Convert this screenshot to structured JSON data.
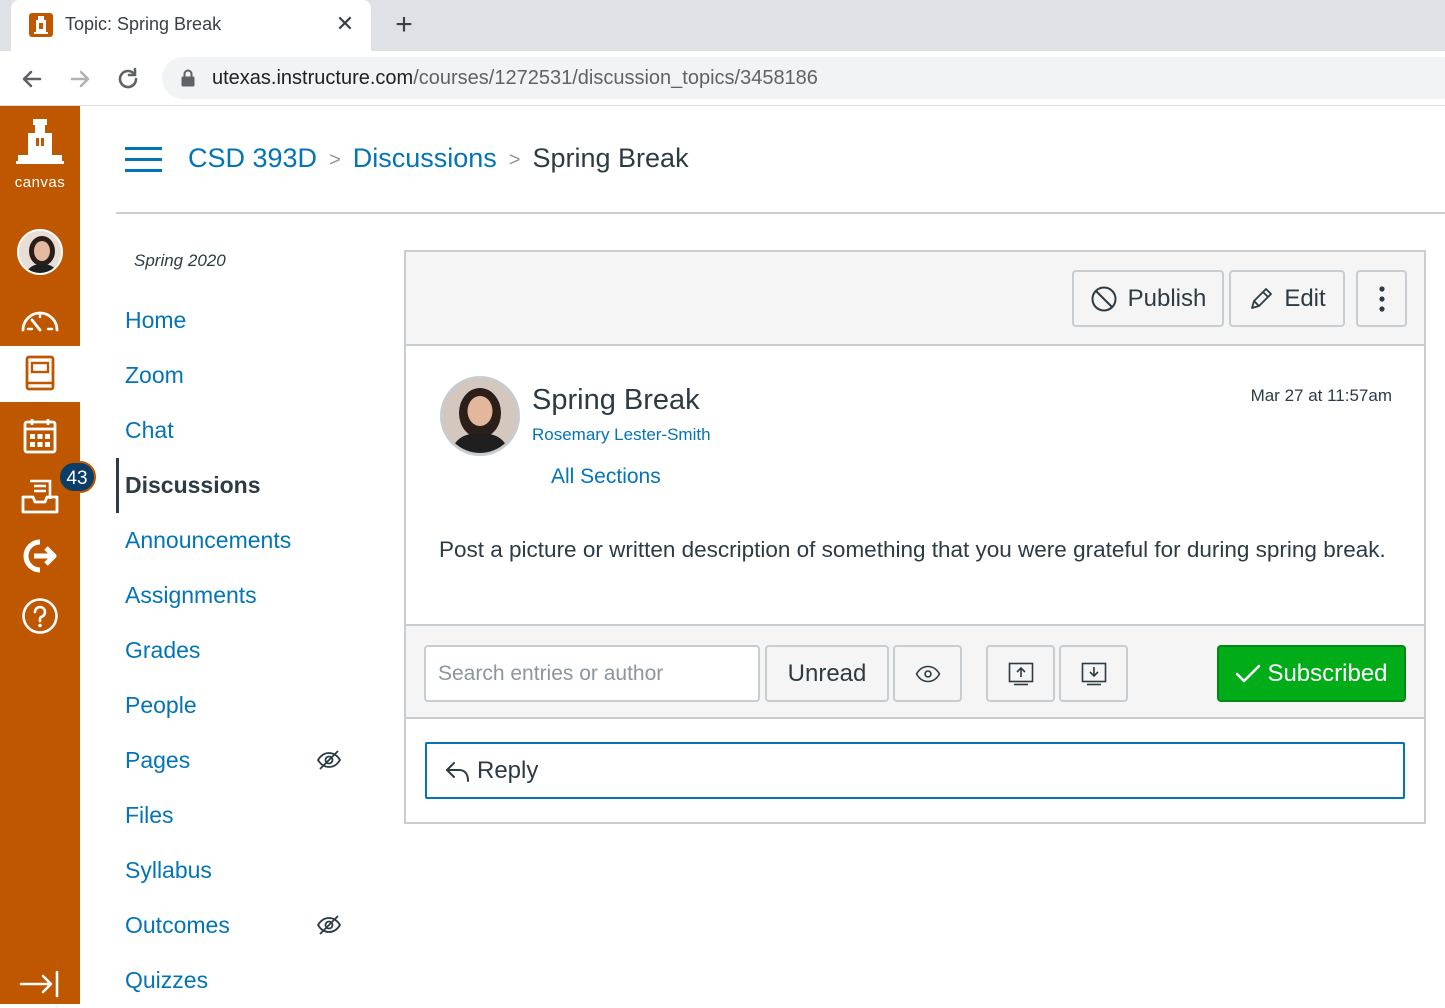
{
  "browser": {
    "tab_title": "Topic: Spring Break",
    "url_host": "utexas.instructure.com",
    "url_path": "/courses/1272531/discussion_topics/3458186"
  },
  "global_nav": {
    "logo_text": "canvas",
    "inbox_badge": "43",
    "items": [
      "account",
      "dashboard",
      "courses",
      "calendar",
      "inbox",
      "commons",
      "help",
      "collapse"
    ]
  },
  "breadcrumb": {
    "course": "CSD 393D",
    "section": "Discussions",
    "current": "Spring Break"
  },
  "course_nav": {
    "term": "Spring 2020",
    "items": [
      {
        "label": "Home"
      },
      {
        "label": "Zoom"
      },
      {
        "label": "Chat"
      },
      {
        "label": "Discussions",
        "active": true
      },
      {
        "label": "Announcements"
      },
      {
        "label": "Assignments"
      },
      {
        "label": "Grades"
      },
      {
        "label": "People"
      },
      {
        "label": "Pages",
        "hidden_icon": true
      },
      {
        "label": "Files"
      },
      {
        "label": "Syllabus"
      },
      {
        "label": "Outcomes",
        "hidden_icon": true
      },
      {
        "label": "Quizzes"
      }
    ]
  },
  "toolbar": {
    "publish_label": "Publish",
    "edit_label": "Edit"
  },
  "topic": {
    "title": "Spring Break",
    "author": "Rosemary Lester-Smith",
    "sections": "All Sections",
    "posted": "Mar 27 at 11:57am",
    "body": "Post a picture or written description of something that you were grateful for during spring break."
  },
  "filters": {
    "search_placeholder": "Search entries or author",
    "unread_label": "Unread",
    "subscribed_label": "Subscribed"
  },
  "reply": {
    "label": "Reply"
  },
  "colors": {
    "brand_orange": "#bf5700",
    "link_blue": "#0374b5",
    "subscribed_green": "#00ac18"
  }
}
